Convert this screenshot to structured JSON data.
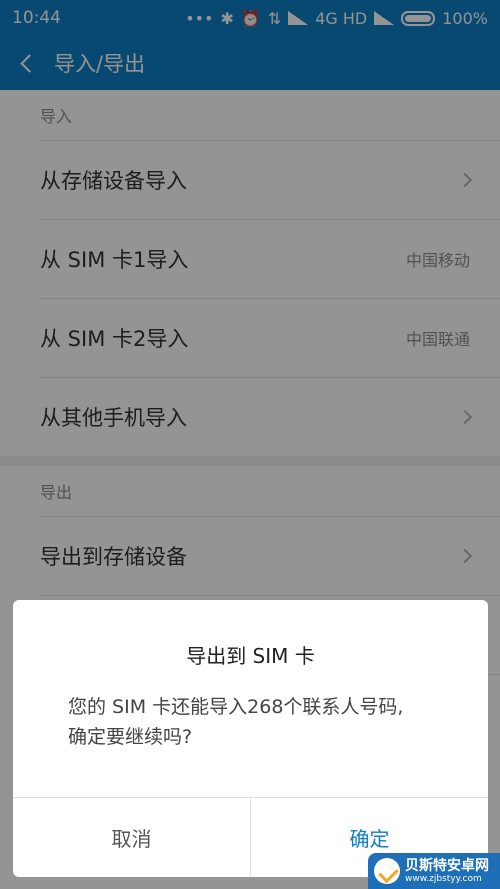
{
  "status": {
    "time": "10:44",
    "icons": [
      "more-dots-icon",
      "bluetooth-icon",
      "alarm-icon",
      "data-transfer-icon",
      "signal-icon",
      "signal-icon"
    ],
    "network": "4G HD",
    "battery": "100%"
  },
  "header": {
    "title": "导入/导出"
  },
  "import": {
    "heading": "导入",
    "items": [
      {
        "label": "从存储设备导入"
      },
      {
        "label": "从 SIM 卡1导入",
        "value": "中国移动"
      },
      {
        "label": "从 SIM 卡2导入",
        "value": "中国联通"
      },
      {
        "label": "从其他手机导入"
      }
    ]
  },
  "export": {
    "heading": "导出",
    "items": [
      {
        "label": "导出到存储设备"
      }
    ]
  },
  "dialog": {
    "title": "导出到 SIM 卡",
    "message_line1": "您的 SIM 卡还能导入268个联系人号码,",
    "message_line2": "确定要继续吗?",
    "cancel": "取消",
    "confirm": "确定"
  },
  "watermark": {
    "name": "贝斯特安卓网",
    "url": "www.zjbstyy.com"
  },
  "colors": {
    "accent": "#0e7fc3"
  }
}
